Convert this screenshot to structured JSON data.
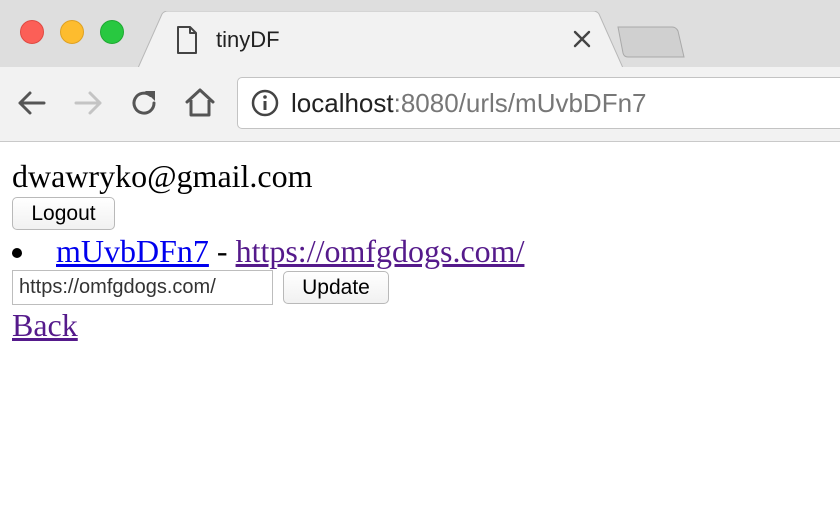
{
  "browser": {
    "tab": {
      "title": "tinyDF"
    },
    "address": {
      "host": "localhost",
      "rest": ":8080/urls/mUvbDFn7"
    },
    "icons": [
      "document-icon",
      "close-icon",
      "back-arrow-icon",
      "forward-arrow-icon",
      "reload-icon",
      "home-icon",
      "info-icon"
    ]
  },
  "page": {
    "user_email": "dwawryko@gmail.com",
    "logout_label": "Logout",
    "url_item": {
      "short_id": "mUvbDFn7",
      "separator": " - ",
      "long_url": "https://omfgdogs.com/"
    },
    "edit": {
      "input_value": "https://omfgdogs.com/",
      "update_label": "Update"
    },
    "back_label": "Back"
  },
  "colors": {
    "link": "#0000ee",
    "visited_link": "#551a8b",
    "close_red": "#fc5f57",
    "minimize_yellow": "#fdbc2e",
    "zoom_green": "#28c840"
  }
}
